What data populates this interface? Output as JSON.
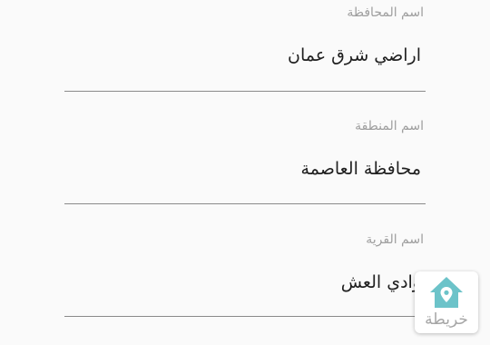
{
  "form": {
    "fields": [
      {
        "label": "اسم المحافظة",
        "value": "اراضي شرق عمان"
      },
      {
        "label": "اسم المنطقة",
        "value": "محافظة العاصمة"
      },
      {
        "label": "اسم القرية",
        "value": "وادي العش"
      }
    ]
  },
  "map_button": {
    "label": "خريطة",
    "icon": "home-location-icon",
    "icon_color": "#6cc3c9"
  }
}
